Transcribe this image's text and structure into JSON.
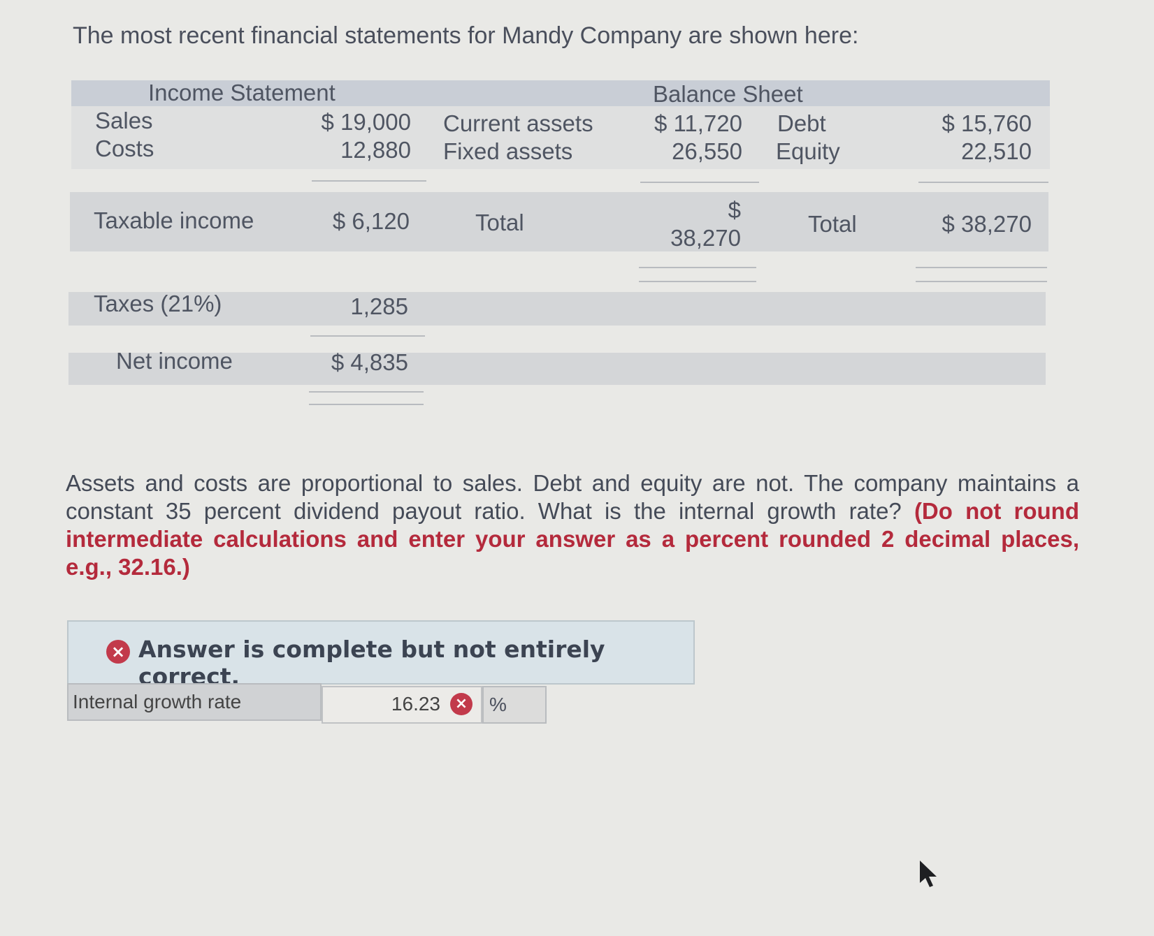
{
  "intro": "The most recent financial statements for Mandy Company are shown here:",
  "income_statement": {
    "title": "Income Statement",
    "rows": [
      {
        "label": "Sales",
        "value": "$ 19,000"
      },
      {
        "label": "Costs",
        "value": "12,880"
      },
      {
        "label": "Taxable income",
        "value": "$ 6,120"
      },
      {
        "label": "Taxes (21%)",
        "value": "1,285"
      },
      {
        "label": "Net income",
        "value": "$ 4,835"
      }
    ]
  },
  "balance_sheet": {
    "title": "Balance Sheet",
    "assets": [
      {
        "label": "Current assets",
        "value": "$ 11,720"
      },
      {
        "label": "Fixed assets",
        "value": "26,550"
      }
    ],
    "assets_total": {
      "label": "Total",
      "currency": "$",
      "value": "38,270"
    },
    "liabilities": [
      {
        "label": "Debt",
        "value": "$ 15,760"
      },
      {
        "label": "Equity",
        "value": "22,510"
      }
    ],
    "liabilities_total": {
      "label": "Total",
      "value": "$ 38,270"
    }
  },
  "question": {
    "text": "Assets and costs are proportional to sales. Debt and equity are not. The company maintains a constant 35 percent dividend payout ratio. What is the internal growth rate?",
    "instruction": "(Do not round intermediate calculations and enter your answer as a percent rounded 2 decimal places, e.g., 32.16.)"
  },
  "feedback": {
    "message": "Answer is complete but not entirely correct.",
    "icon": "x-circle-icon",
    "color": "#c23a4b"
  },
  "answer": {
    "label": "Internal growth rate",
    "value": "16.23",
    "unit": "%",
    "status": "incorrect"
  }
}
